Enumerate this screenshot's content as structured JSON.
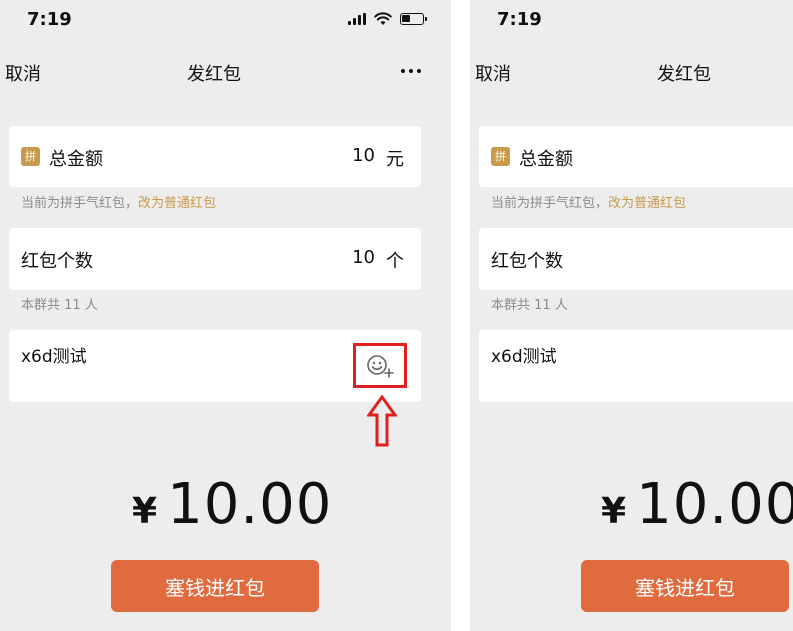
{
  "left": {
    "status": {
      "time": "7:19"
    },
    "nav": {
      "cancel": "取消",
      "title": "发红包"
    },
    "amount_card": {
      "badge": "拼",
      "label": "总金额",
      "value": "10",
      "unit": "元"
    },
    "type_hint": {
      "prefix": "当前为拼手气红包，",
      "link": "改为普通红包"
    },
    "count_card": {
      "label": "红包个数",
      "value": "10",
      "unit": "个"
    },
    "members_hint": "本群共 11 人",
    "greeting": "x6d测试",
    "total": {
      "currency": "¥",
      "value": "10.00"
    },
    "submit_label": "塞钱进红包"
  },
  "right": {
    "status": {
      "time": "7:19"
    },
    "nav": {
      "cancel": "取消",
      "title": "发红包"
    },
    "amount_card": {
      "badge": "拼",
      "label": "总金额"
    },
    "type_hint": {
      "prefix": "当前为拼手气红包，",
      "link": "改为普通红包"
    },
    "count_card": {
      "label": "红包个数"
    },
    "members_hint": "本群共 11 人",
    "greeting": "x6d测试",
    "total": {
      "currency": "¥",
      "value": "10.00"
    },
    "submit_label": "塞钱进红包"
  },
  "colors": {
    "accent": "#e06b3f",
    "gold": "#c99a4c",
    "highlight": "#e02020",
    "background": "#ededed"
  },
  "icons": [
    "signal-icon",
    "wifi-icon",
    "battery-icon",
    "more-icon",
    "emoji-add-icon",
    "arrow-up-icon"
  ]
}
